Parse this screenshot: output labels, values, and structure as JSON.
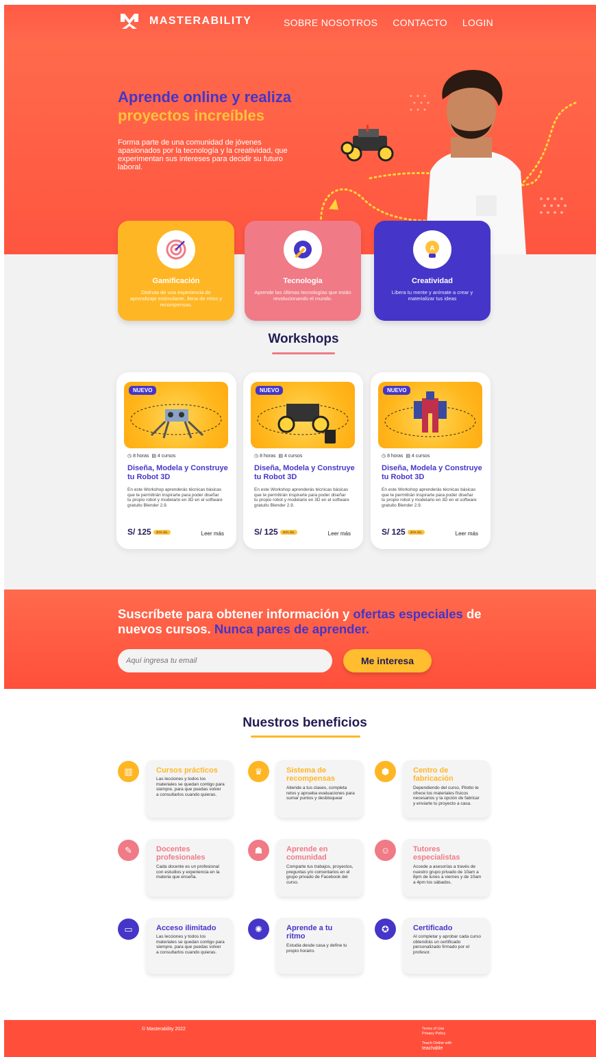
{
  "nav": {
    "brand": "MASTERABILITY",
    "links": [
      "SOBRE NOSOTROS",
      "CONTACTO",
      "LOGIN"
    ]
  },
  "hero": {
    "title_line1": "Aprende online y realiza",
    "title_line2": "proyectos increíbles",
    "description": "Forma parte de una comunidad de jóvenes apasionados por la tecnología y la creatividad, que experimentan sus intereses para decidir su futuro laboral."
  },
  "features": [
    {
      "title": "Gamificación",
      "text": "Disfruta de una experiencia de aprendizaje estimulante, llena de retos y recompensas.",
      "color": "#ffb624",
      "icon": "target-icon"
    },
    {
      "title": "Tecnología",
      "text": "Aprende las últimas tecnologías que están revolucionando el mundo.",
      "color": "#f07a85",
      "icon": "wrench-gear-icon"
    },
    {
      "title": "Creatividad",
      "text": "Libera tu mente y anímate a crear y materializar tus ideas",
      "color": "#4535c8",
      "icon": "lightbulb-icon"
    }
  ],
  "workshops": {
    "title": "Workshops",
    "items": [
      {
        "badge": "NUEVO",
        "hours": "8 horas",
        "courses": "4 cursos",
        "title": "Diseña, Modela y Construye tu Robot 3D",
        "desc": "En este Workshop aprenderás técnicas básicas que te permitirán inspirarte para poder diseñar tu propio robot y modelarlo en 3D en el software gratuito Blender 2.9.",
        "price": "S/ 125",
        "discount": "30% dto.",
        "more": "Leer más"
      },
      {
        "badge": "NUEVO",
        "hours": "8 horas",
        "courses": "4 cursos",
        "title": "Diseña, Modela y Construye tu Robot 3D",
        "desc": "En este Workshop aprenderás técnicas básicas que te permitirán inspirarte para poder diseñar tu propio robot y modelarlo en 3D en el software gratuito Blender 2.9.",
        "price": "S/ 125",
        "discount": "30% dto.",
        "more": "Leer más"
      },
      {
        "badge": "NUEVO",
        "hours": "8 horas",
        "courses": "4 cursos",
        "title": "Diseña, Modela y Construye tu Robot 3D",
        "desc": "En este Workshop aprenderás técnicas básicas que te permitirán inspirarte para poder diseñar tu propio robot y modelarlo en 3D en el software gratuito Blender 2.9.",
        "price": "S/ 125",
        "discount": "30% dto.",
        "more": "Leer más"
      }
    ]
  },
  "subscribe": {
    "title_a": "Suscríbete para obtener información y ",
    "title_b": "ofertas especiales",
    "title_c": " de nuevos cursos. ",
    "title_d": "Nunca pares de aprender.",
    "placeholder": "Aquí ingresa tu email",
    "button": "Me interesa"
  },
  "benefits": {
    "title": "Nuestros beneficios",
    "items": [
      {
        "title": "Cursos prácticos",
        "desc": "Las lecciones y todos los materiales se quedan contigo para siempre, para que puedas volver a consultarlos cuando quieras.",
        "color": "#ffb624",
        "icon": "books-icon"
      },
      {
        "title": "Sistema de recompensas",
        "desc": "Atiende a tus clases, completa retos y aprueba evaluaciones para sumar puntos y desbloquear",
        "color": "#ffb624",
        "icon": "trophy-icon"
      },
      {
        "title": "Centro de fabricación",
        "desc": "Dependiendo del curso, Pilotto te ofrece los materiales físicos necesarios y la opción de fabricar y enviarte tu proyecto a casa.",
        "color": "#ffb624",
        "icon": "cubes-icon"
      },
      {
        "title": "Docentes profesionales",
        "desc": "Cada docente es un profesional con estudios y experiencia en la materia que enseña.",
        "color": "#f07a85",
        "icon": "teacher-icon"
      },
      {
        "title": "Aprende en comunidad",
        "desc": "Comparte tus trabajos, proyectos, preguntas y/o comentarios en el grupo privado de Facebook del curso.",
        "color": "#f07a85",
        "icon": "community-icon"
      },
      {
        "title": "Tutores especialistas",
        "desc": "Accede a asesorías a través de nuestro grupo privado de 10am a 8pm de lunes a viernes y de 10am a 4pm los sábados.",
        "color": "#f07a85",
        "icon": "tutor-icon"
      },
      {
        "title": "Acceso ilimitado",
        "desc": "Las lecciones y todos los materiales se quedan contigo para siempre, para que puedas volver a consultarlos cuando quieras.",
        "color": "#4535c8",
        "icon": "monitor-icon"
      },
      {
        "title": "Aprende a tu ritmo",
        "desc": "Estudia desde casa y define tu propio horario.",
        "color": "#4535c8",
        "icon": "bulb-head-icon"
      },
      {
        "title": "Certificado",
        "desc": "Al completar y aprobar cada curso obtendrás un certificado personalizado firmado por el profesor.",
        "color": "#4535c8",
        "icon": "certificate-icon"
      }
    ]
  },
  "footer": {
    "copyright": "© Masterability 2022",
    "terms": "Terms of Use",
    "privacy": "Privacy Policy",
    "teach": "Teach Online with",
    "teach_brand": "teachable"
  }
}
